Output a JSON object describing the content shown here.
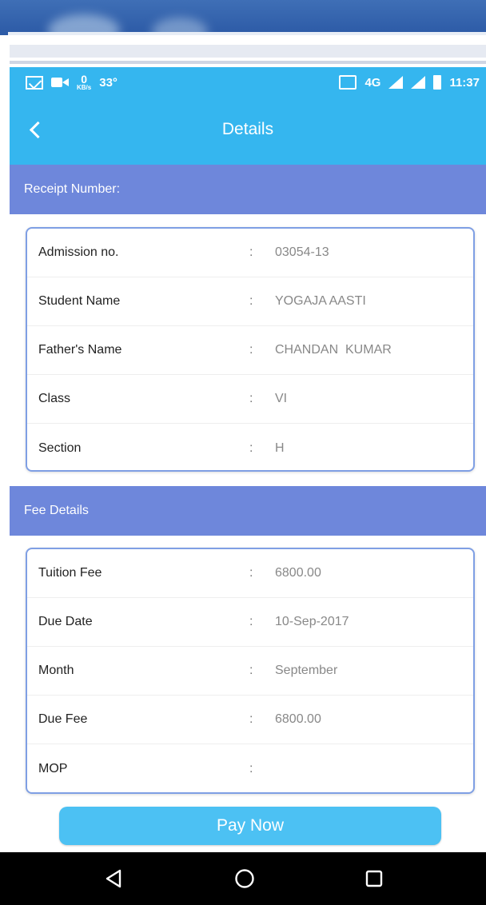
{
  "status_bar": {
    "network_speed_value": "0",
    "network_speed_unit": "KB/s",
    "temperature": "33°",
    "network_type": "4G",
    "time": "11:37"
  },
  "header": {
    "title": "Details"
  },
  "receipt_section": {
    "label": "Receipt Number:"
  },
  "student_details": [
    {
      "label": "Admission no.",
      "sep": ":",
      "value": "03054-13"
    },
    {
      "label": "Student Name",
      "sep": ":",
      "value": "YOGAJA AASTI"
    },
    {
      "label": "Father's Name",
      "sep": ":",
      "value": "CHANDAN  KUMAR"
    },
    {
      "label": "Class",
      "sep": ":",
      "value": "VI"
    },
    {
      "label": "Section",
      "sep": ":",
      "value": "H"
    }
  ],
  "fee_section": {
    "label": "Fee Details"
  },
  "fee_details": [
    {
      "label": "Tuition Fee",
      "sep": ":",
      "value": "6800.00"
    },
    {
      "label": "Due Date",
      "sep": ":",
      "value": "10-Sep-2017"
    },
    {
      "label": "Month",
      "sep": ":",
      "value": "September"
    },
    {
      "label": "Due Fee",
      "sep": ":",
      "value": "6800.00"
    },
    {
      "label": "MOP",
      "sep": ":",
      "value": ""
    }
  ],
  "actions": {
    "pay_now_label": "Pay Now"
  },
  "colors": {
    "primary": "#35b6ef",
    "section_band": "#6e87db",
    "card_border": "#7f9fe4",
    "button": "#4cc1f3"
  },
  "icons": {
    "back": "chevron-left-icon",
    "nav_back": "triangle-back-icon",
    "nav_home": "circle-home-icon",
    "nav_recent": "square-recent-icon"
  }
}
